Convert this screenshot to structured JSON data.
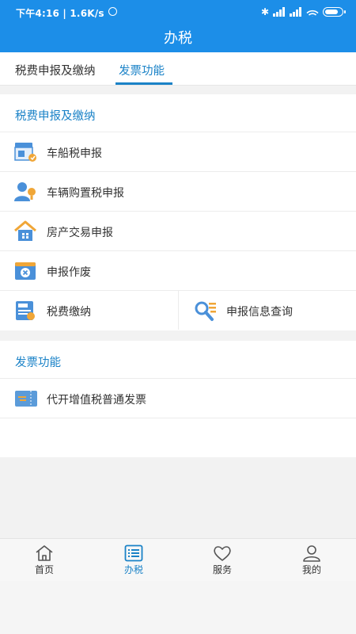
{
  "status_bar": {
    "time": "下午4:16 | 1.6K/s",
    "bluetooth": "✱"
  },
  "header": {
    "title": "办税"
  },
  "tabs": [
    {
      "label": "税费申报及缴纳",
      "active": false
    },
    {
      "label": "发票功能",
      "active": true
    }
  ],
  "sections": [
    {
      "title": "税费申报及缴纳",
      "items": [
        {
          "label": "车船税申报",
          "icon": "vehicle-vessel-tax-icon"
        },
        {
          "label": "车辆购置税申报",
          "icon": "vehicle-purchase-tax-icon"
        },
        {
          "label": "房产交易申报",
          "icon": "house-icon"
        },
        {
          "label": "申报作废",
          "icon": "void-declaration-icon"
        }
      ],
      "split_row": [
        {
          "label": "税费缴纳",
          "icon": "tax-payment-icon"
        },
        {
          "label": "申报信息查询",
          "icon": "search-info-icon"
        }
      ]
    },
    {
      "title": "发票功能",
      "items": [
        {
          "label": "代开增值税普通发票",
          "icon": "invoice-icon"
        }
      ]
    }
  ],
  "bottom_nav": [
    {
      "label": "首页",
      "icon": "home-icon",
      "active": false
    },
    {
      "label": "办税",
      "icon": "list-icon",
      "active": true
    },
    {
      "label": "服务",
      "icon": "heart-icon",
      "active": false
    },
    {
      "label": "我的",
      "icon": "person-icon",
      "active": false
    }
  ],
  "colors": {
    "header_bg": "#1c8ee8",
    "accent": "#1a82c7"
  }
}
